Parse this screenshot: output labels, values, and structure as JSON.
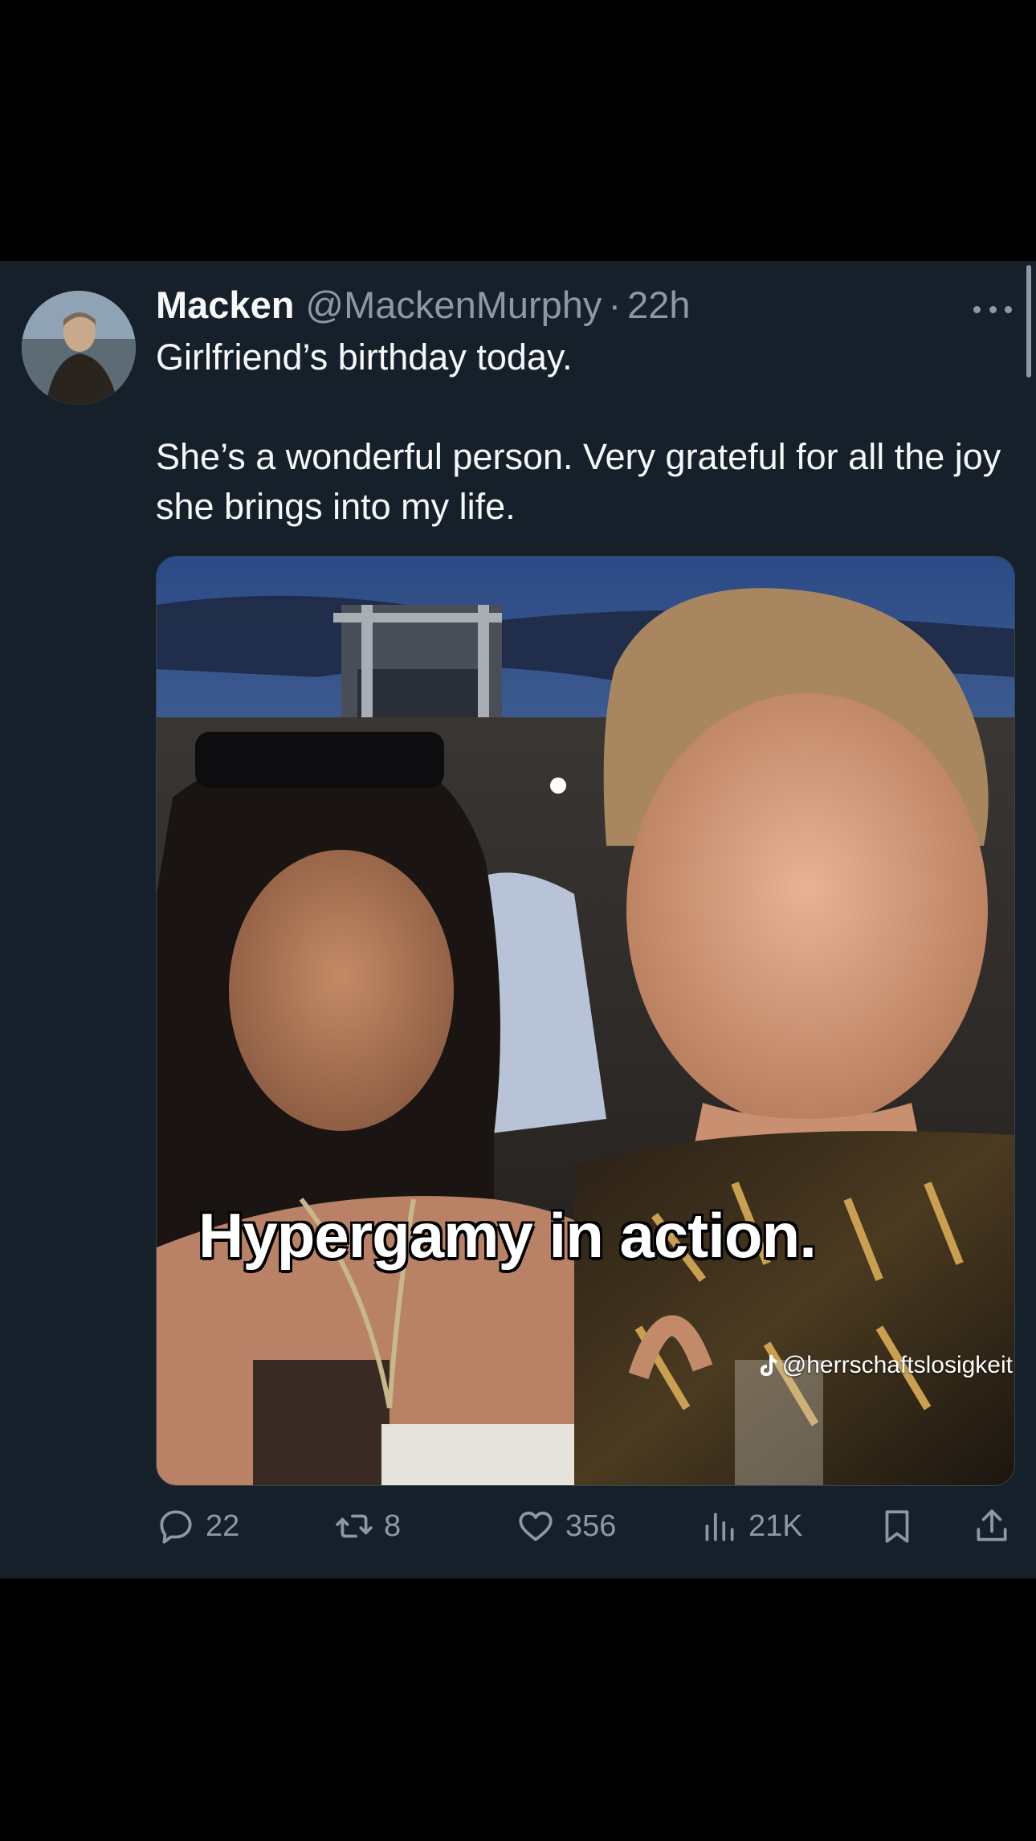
{
  "tweet": {
    "author": {
      "display_name": "Macken",
      "handle": "@MackenMurphy",
      "separator": "·",
      "timestamp": "22h"
    },
    "text_lines": [
      "Girlfriend’s birthday today.",
      "She’s a wonderful person. Very grateful for all the joy she brings into my life."
    ],
    "media": {
      "caption": "Hypergamy in action.",
      "watermark": "@herrschaftslosigkeit"
    },
    "actions": {
      "replies": "22",
      "retweets": "8",
      "likes": "356",
      "views": "21K"
    }
  },
  "theme": {
    "background": "#000000",
    "card_background": "#15202b",
    "primary_text": "#f7f9f9",
    "secondary_text": "#8b98a5"
  },
  "icons": {
    "more": "more-horizontal-icon",
    "reply": "reply-icon",
    "retweet": "retweet-icon",
    "like": "heart-icon",
    "views": "views-icon",
    "bookmark": "bookmark-icon",
    "share": "share-icon",
    "tiktok": "tiktok-icon"
  }
}
